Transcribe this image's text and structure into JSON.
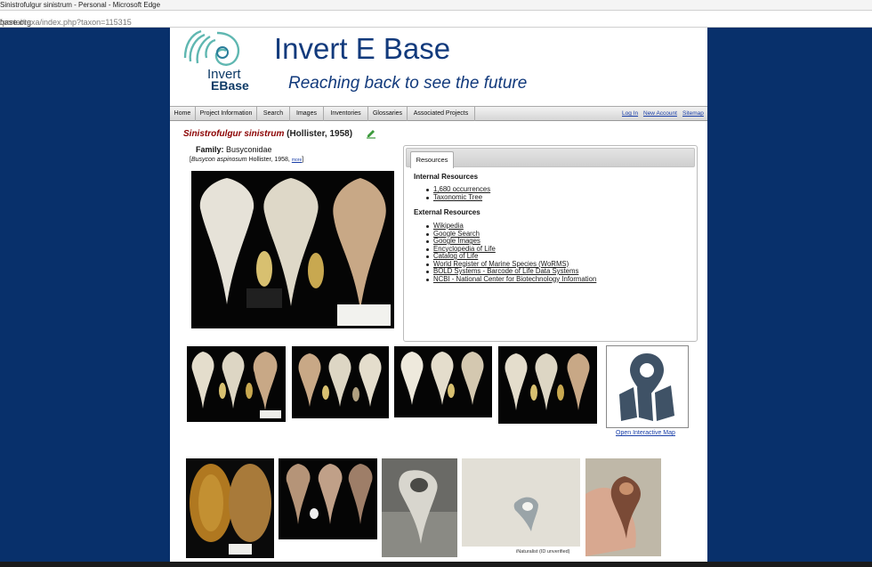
{
  "browser": {
    "window_title": "Sinistrofulgur sinistrum - Personal - Microsoft Edge",
    "url_host": "base.org",
    "url_path": "/portal/taxa/index.php?taxon=115315"
  },
  "header": {
    "logo_line1": "Invert",
    "logo_line2": "EBase",
    "site_title": "Invert E Base",
    "tagline": "Reaching back to see the future"
  },
  "nav": {
    "items": [
      "Home",
      "Project Information",
      "Search",
      "Images",
      "Inventories",
      "Glossaries",
      "Associated Projects"
    ],
    "login": "Log In",
    "new_account": "New Account",
    "sitemap": "Sitemap"
  },
  "taxon": {
    "scientific_name": "Sinistrofulgur sinistrum",
    "author": "(Hollister, 1958)",
    "family_label": "Family:",
    "family": "Busyconidae",
    "synonym_open": "[",
    "synonym_name": "Busycon aspinosum",
    "synonym_author": "Hollister, 1958,",
    "synonym_more": "more",
    "synonym_close": "]"
  },
  "resources": {
    "tab_label": "Resources",
    "internal_heading": "Internal Resources",
    "internal_links": [
      "1,680 occurrences",
      "Taxonomic Tree"
    ],
    "external_heading": "External Resources",
    "external_links": [
      "Wikipedia",
      "Google Search",
      "Google Images",
      "Encyclopedia of Life",
      "Catalog of Life",
      "World Register of Marine Species (WoRMS)",
      "BOLD Systems - Barcode of Life Data Systems",
      "NCBI - National Center for Biotechnology Information"
    ]
  },
  "map": {
    "link_label": "Open Interactive Map"
  },
  "gallery": {
    "caption": "iNaturalist (ID unverified)"
  },
  "colors": {
    "background": "#08306b",
    "title_blue": "#123a7c",
    "taxon_red": "#8b0000",
    "link_blue": "#1a3fa8"
  }
}
